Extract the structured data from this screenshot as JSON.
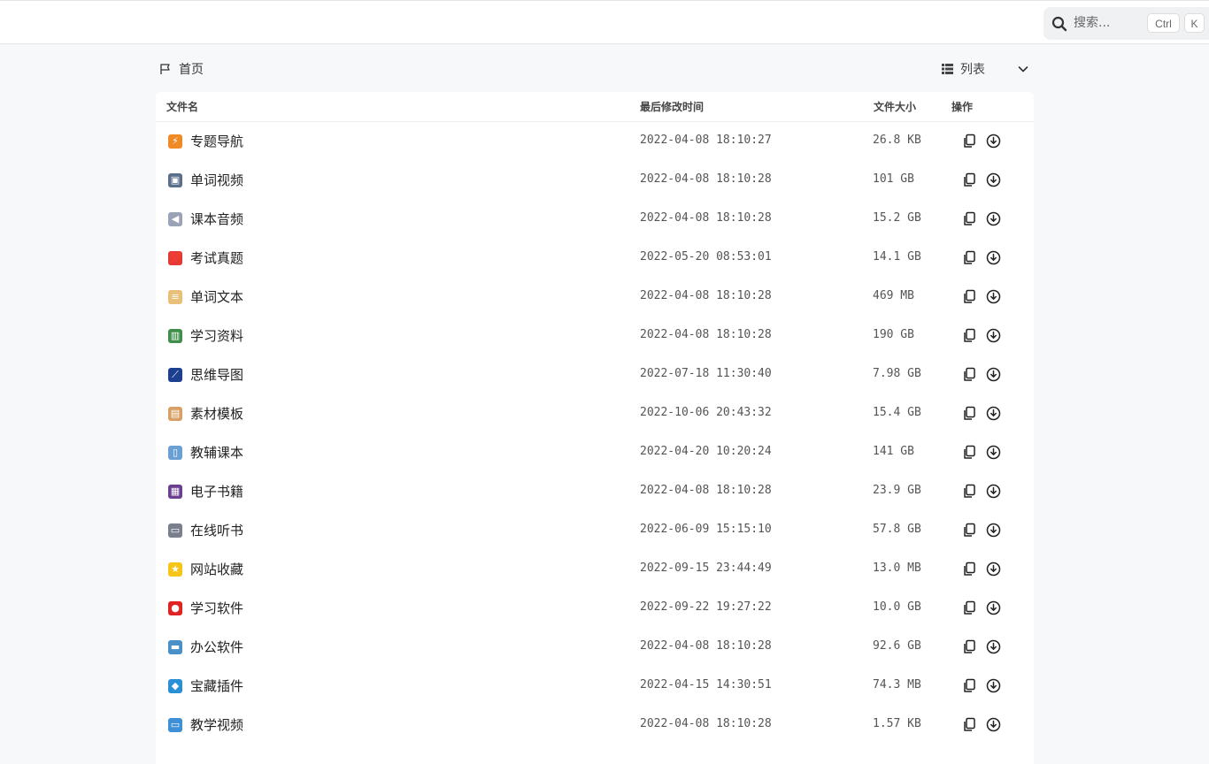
{
  "search": {
    "placeholder": "搜索...",
    "kbd_ctrl": "Ctrl",
    "kbd_k": "K"
  },
  "breadcrumb": {
    "home": "首页"
  },
  "view": {
    "label": "列表"
  },
  "table": {
    "headers": {
      "name": "文件名",
      "modified": "最后修改时间",
      "size": "文件大小",
      "ops": "操作"
    },
    "rows": [
      {
        "name": "专题导航",
        "modified": "2022-04-08 18:10:27",
        "size": "26.8 KB",
        "icon": "lightning-icon",
        "color": "#f08a24",
        "glyph": "⚡"
      },
      {
        "name": "单词视频",
        "modified": "2022-04-08 18:10:28",
        "size": "101 GB",
        "icon": "television-icon",
        "color": "#5b6f8a",
        "glyph": "▣"
      },
      {
        "name": "课本音频",
        "modified": "2022-04-08 18:10:28",
        "size": "15.2 GB",
        "icon": "speaker-icon",
        "color": "#9aa3b5",
        "glyph": "◀"
      },
      {
        "name": "考试真题",
        "modified": "2022-05-20 08:53:01",
        "size": "14.1 GB",
        "icon": "hundred-points-icon",
        "color": "#e53935",
        "glyph": "💯"
      },
      {
        "name": "单词文本",
        "modified": "2022-04-08 18:10:28",
        "size": "469 MB",
        "icon": "scroll-icon",
        "color": "#e8c07a",
        "glyph": "≡"
      },
      {
        "name": "学习资料",
        "modified": "2022-04-08 18:10:28",
        "size": "190 GB",
        "icon": "books-icon",
        "color": "#3f8f4a",
        "glyph": "▥"
      },
      {
        "name": "思维导图",
        "modified": "2022-07-18 11:30:40",
        "size": "7.98 GB",
        "icon": "mind-map-icon",
        "color": "#1d3f8f",
        "glyph": "⟋"
      },
      {
        "name": "素材模板",
        "modified": "2022-10-06 20:43:32",
        "size": "15.4 GB",
        "icon": "clipboard-icon",
        "color": "#d9a066",
        "glyph": "▤"
      },
      {
        "name": "教辅课本",
        "modified": "2022-04-20 10:20:24",
        "size": "141 GB",
        "icon": "open-book-icon",
        "color": "#6a9fd4",
        "glyph": "▯"
      },
      {
        "name": "电子书籍",
        "modified": "2022-04-08 18:10:28",
        "size": "23.9 GB",
        "icon": "notebook-icon",
        "color": "#6b3f8f",
        "glyph": "▦"
      },
      {
        "name": "在线听书",
        "modified": "2022-06-09 15:15:10",
        "size": "57.8 GB",
        "icon": "radio-icon",
        "color": "#7a7f8c",
        "glyph": "▭"
      },
      {
        "name": "网站收藏",
        "modified": "2022-09-15 23:44:49",
        "size": "13.0 MB",
        "icon": "star-icon",
        "color": "#f5c518",
        "glyph": "★"
      },
      {
        "name": "学习软件",
        "modified": "2022-09-22 19:27:22",
        "size": "10.0 GB",
        "icon": "apple-icon",
        "color": "#e02424",
        "glyph": "●"
      },
      {
        "name": "办公软件",
        "modified": "2022-04-08 18:10:28",
        "size": "92.6 GB",
        "icon": "laptop-icon",
        "color": "#4a90c8",
        "glyph": "▬"
      },
      {
        "name": "宝藏插件",
        "modified": "2022-04-15 14:30:51",
        "size": "74.3 MB",
        "icon": "gem-icon",
        "color": "#2b8fd6",
        "glyph": "◆"
      },
      {
        "name": "教学视频",
        "modified": "2022-04-08 18:10:28",
        "size": "1.57 KB",
        "icon": "desktop-icon",
        "color": "#3d8fd6",
        "glyph": "▭"
      }
    ]
  }
}
